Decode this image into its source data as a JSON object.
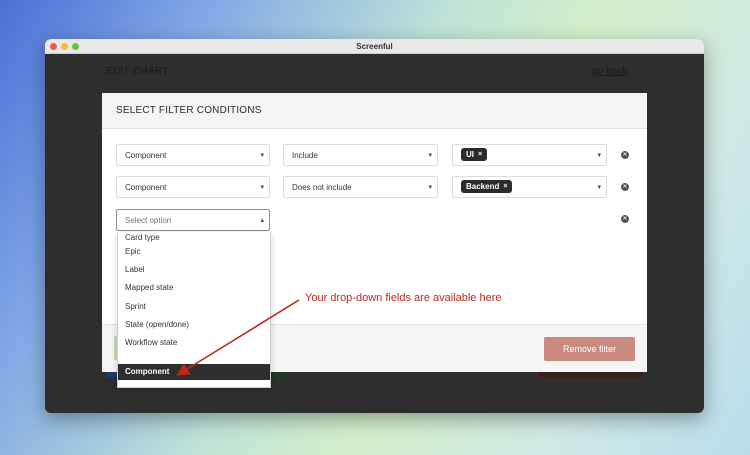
{
  "window": {
    "title": "Screenful"
  },
  "header": {
    "edit_chart": "EDIT CHART",
    "go_back_arrow": "‹",
    "go_back": "go back"
  },
  "modal": {
    "title": "SELECT FILTER CONDITIONS",
    "rows": [
      {
        "field": "Component",
        "operator": "Include",
        "tag": "UI"
      },
      {
        "field": "Component",
        "operator": "Does not include",
        "tag": "Backend"
      }
    ],
    "new_row_placeholder": "Select option",
    "remove_filter": "Remove filter"
  },
  "dropdown": {
    "options": [
      "Card type",
      "Epic",
      "Label",
      "Mapped state",
      "Sprint",
      "State (open/done)",
      "Workflow state"
    ],
    "highlighted": "Component"
  },
  "annotation": {
    "text": "Your drop-down fields are available here",
    "color": "#c0281d"
  },
  "icons": {
    "caret": "▾",
    "caret_up": "▴",
    "tag_remove": "×",
    "row_remove": "✕"
  }
}
